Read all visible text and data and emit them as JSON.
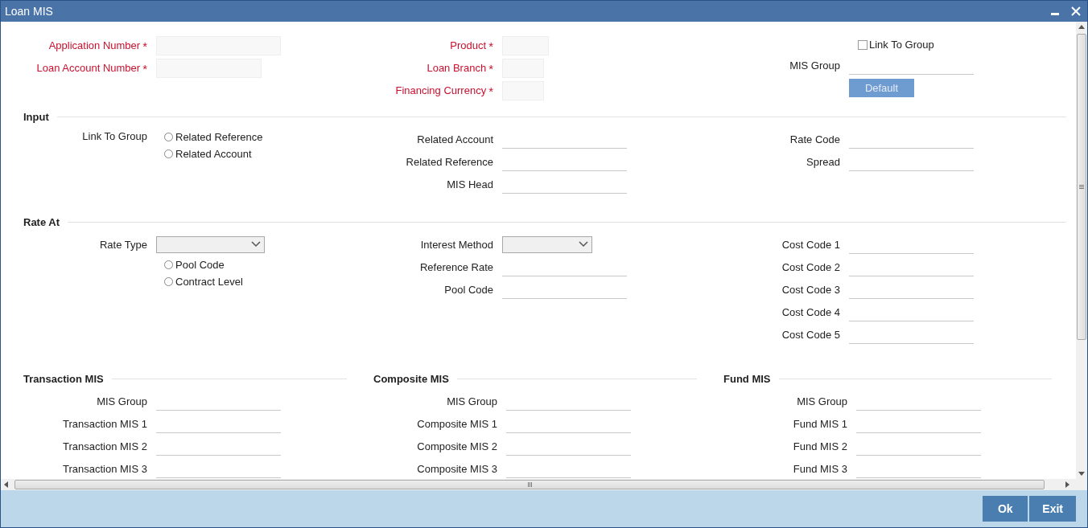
{
  "window": {
    "title": "Loan MIS"
  },
  "header": {
    "columns": [
      [
        {
          "kind": "filled",
          "label": "Application Number",
          "required": true,
          "mark": "*"
        },
        {
          "kind": "filled",
          "label": "Loan Account Number",
          "required": true,
          "mark": "*"
        }
      ],
      [
        {
          "kind": "filled",
          "label": "Product",
          "required": true,
          "mark": "*"
        },
        {
          "kind": "filled",
          "label": "Loan Branch",
          "required": true,
          "mark": "*"
        },
        {
          "kind": "filled",
          "label": "Financing Currency",
          "required": true,
          "mark": "*"
        }
      ],
      [
        {
          "kind": "checkbox",
          "option": "Link To Group",
          "checked": false
        },
        {
          "kind": "line",
          "label": "MIS Group"
        },
        {
          "kind": "button",
          "text": "Default",
          "disabled": true
        }
      ]
    ]
  },
  "sections": [
    {
      "title": "Input",
      "columns": [
        [
          {
            "kind": "radio",
            "label": "Link To Group",
            "option": "Related Reference",
            "selected": false
          },
          {
            "kind": "radio",
            "option": "Related Account",
            "selected": false
          }
        ],
        [
          {
            "kind": "line",
            "label": "Related Account"
          },
          {
            "kind": "line",
            "label": "Related Reference"
          },
          {
            "kind": "line",
            "label": "MIS Head"
          }
        ],
        [
          {
            "kind": "line",
            "label": "Rate Code"
          },
          {
            "kind": "line",
            "label": "Spread"
          }
        ]
      ]
    },
    {
      "title": "Rate At",
      "columns": [
        [
          {
            "kind": "select",
            "label": "Rate Type"
          },
          {
            "kind": "radio",
            "option": "Pool Code",
            "selected": false
          },
          {
            "kind": "radio",
            "option": "Contract Level",
            "selected": false
          }
        ],
        [
          {
            "kind": "select",
            "label": "Interest Method"
          },
          {
            "kind": "line",
            "label": "Reference Rate"
          },
          {
            "kind": "line",
            "label": "Pool Code"
          }
        ],
        [
          {
            "kind": "line",
            "label": "Cost Code 1"
          },
          {
            "kind": "line",
            "label": "Cost Code 2"
          },
          {
            "kind": "line",
            "label": "Cost Code 3"
          },
          {
            "kind": "line",
            "label": "Cost Code 4"
          },
          {
            "kind": "line",
            "label": "Cost Code 5"
          }
        ]
      ]
    }
  ],
  "mis_groups": [
    {
      "title": "Transaction MIS",
      "fields": [
        "MIS Group",
        "Transaction MIS 1",
        "Transaction MIS 2",
        "Transaction MIS 3"
      ]
    },
    {
      "title": "Composite MIS",
      "fields": [
        "MIS Group",
        "Composite MIS 1",
        "Composite MIS 2",
        "Composite MIS 3"
      ]
    },
    {
      "title": "Fund MIS",
      "fields": [
        "MIS Group",
        "Fund MIS 1",
        "Fund MIS 2",
        "Fund MIS 3"
      ]
    }
  ],
  "buttons": [
    "Ok",
    "Exit"
  ]
}
